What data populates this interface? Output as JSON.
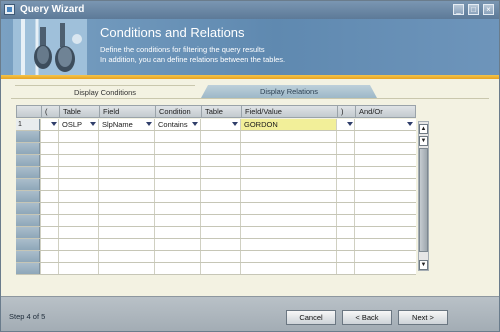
{
  "window": {
    "title": "Query Wizard"
  },
  "header": {
    "title": "Conditions and Relations",
    "description_line1": "Define the conditions for filtering the query results",
    "description_line2": "In addition, you can define relations between the tables."
  },
  "tabs": [
    {
      "label": "Display Conditions",
      "active": true
    },
    {
      "label": "Display Relations",
      "active": false
    }
  ],
  "grid": {
    "columns": [
      "(",
      "Table",
      "Field",
      "Condition",
      "Table",
      "Field/Value",
      ")",
      "And/Or"
    ],
    "rows": [
      {
        "row_number": "1",
        "open_paren": "",
        "table": "OSLP",
        "field": "SlpName",
        "condition": "Contains",
        "table2": "",
        "value": "GORDON",
        "close_paren": "",
        "and_or": ""
      }
    ],
    "empty_row_count": 12
  },
  "footer": {
    "step_text": "Step 4 of 5",
    "cancel_label": "Cancel",
    "back_label": "< Back",
    "next_label": "Next >"
  },
  "colors": {
    "title_bar": "#5d7a98",
    "banner": "#6e95bb",
    "accent_strip": "#e8a322",
    "value_highlight": "#f2ef99"
  },
  "icons": [
    "app-icon",
    "minimize-icon",
    "maximize-icon",
    "close-icon",
    "dropdown-arrow-icon",
    "scroll-up-icon",
    "scroll-down-icon"
  ]
}
